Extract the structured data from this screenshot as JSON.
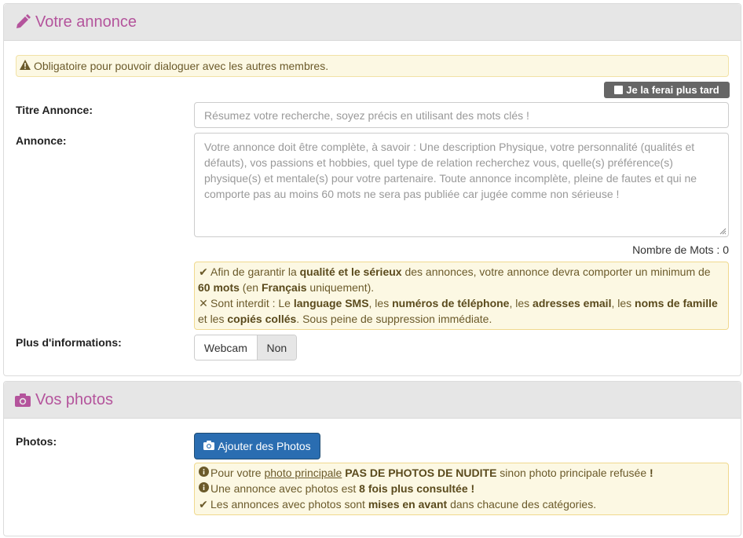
{
  "section1": {
    "title": "Votre annonce",
    "warning": "Obligatoire pour pouvoir dialoguer avec les autres membres.",
    "later_label": "Je la ferai plus tard",
    "titre_label": "Titre Annonce:",
    "titre_placeholder": "Résumez votre recherche, soyez précis en utilisant des mots clés !",
    "annonce_label": "Annonce:",
    "annonce_placeholder": "Votre annonce doit être complète, à savoir : Une description Physique, votre personnalité (qualités et défauts), vos passions et hobbies, quel type de relation recherchez vous, quelle(s) préférence(s) physique(s) et mentale(s) pour votre partenaire. Toute annonce incomplète, pleine de fautes et qui ne comporte pas au moins 60 mots ne sera pas publiée car jugée comme non sérieuse !",
    "word_count": "Nombre de Mots : 0",
    "rules": {
      "l1_a": "Afin de garantir la ",
      "l1_b": "qualité et le sérieux",
      "l1_c": " des annonces, votre annonce devra comporter un minimum de ",
      "l1_d": "60 mots",
      "l1_e": " (en ",
      "l1_f": "Français",
      "l1_g": " uniquement).",
      "l2_a": "Sont interdit : Le ",
      "l2_b": "language SMS",
      "l2_c": ", les ",
      "l2_d": "numéros de téléphone",
      "l2_e": ", les ",
      "l2_f": "adresses email",
      "l2_g": ", les ",
      "l2_h": "noms de famille",
      "l2_i": " et les ",
      "l2_j": "copiés collés",
      "l2_k": ". Sous peine de suppression immédiate."
    },
    "more_label": "Plus d'informations:",
    "toggle": {
      "option_a": "Webcam",
      "option_b": "Non"
    }
  },
  "section2": {
    "title": "Vos photos",
    "photos_label": "Photos:",
    "add_button": "Ajouter des Photos",
    "notes": {
      "n1_a": "Pour votre ",
      "n1_b": "photo principale",
      "n1_c": " ",
      "n1_d": "PAS DE PHOTOS DE NUDITE",
      "n1_e": " sinon photo principale refusée ",
      "n1_f": "!",
      "n2_a": "Une annonce avec photos est ",
      "n2_b": "8 fois plus consultée !",
      "n3_a": "Les annonces avec photos sont ",
      "n3_b": "mises en avant",
      "n3_c": " dans chacune des catégories."
    }
  },
  "colors": {
    "accent": "#b4549c",
    "primary_button": "#2a6db1",
    "note_bg": "#fcf8e3",
    "later_bg": "#666666"
  },
  "icons": [
    "pencil-icon",
    "warning-icon",
    "checkbox-icon",
    "check-icon",
    "times-icon",
    "camera-icon",
    "info-icon"
  ]
}
